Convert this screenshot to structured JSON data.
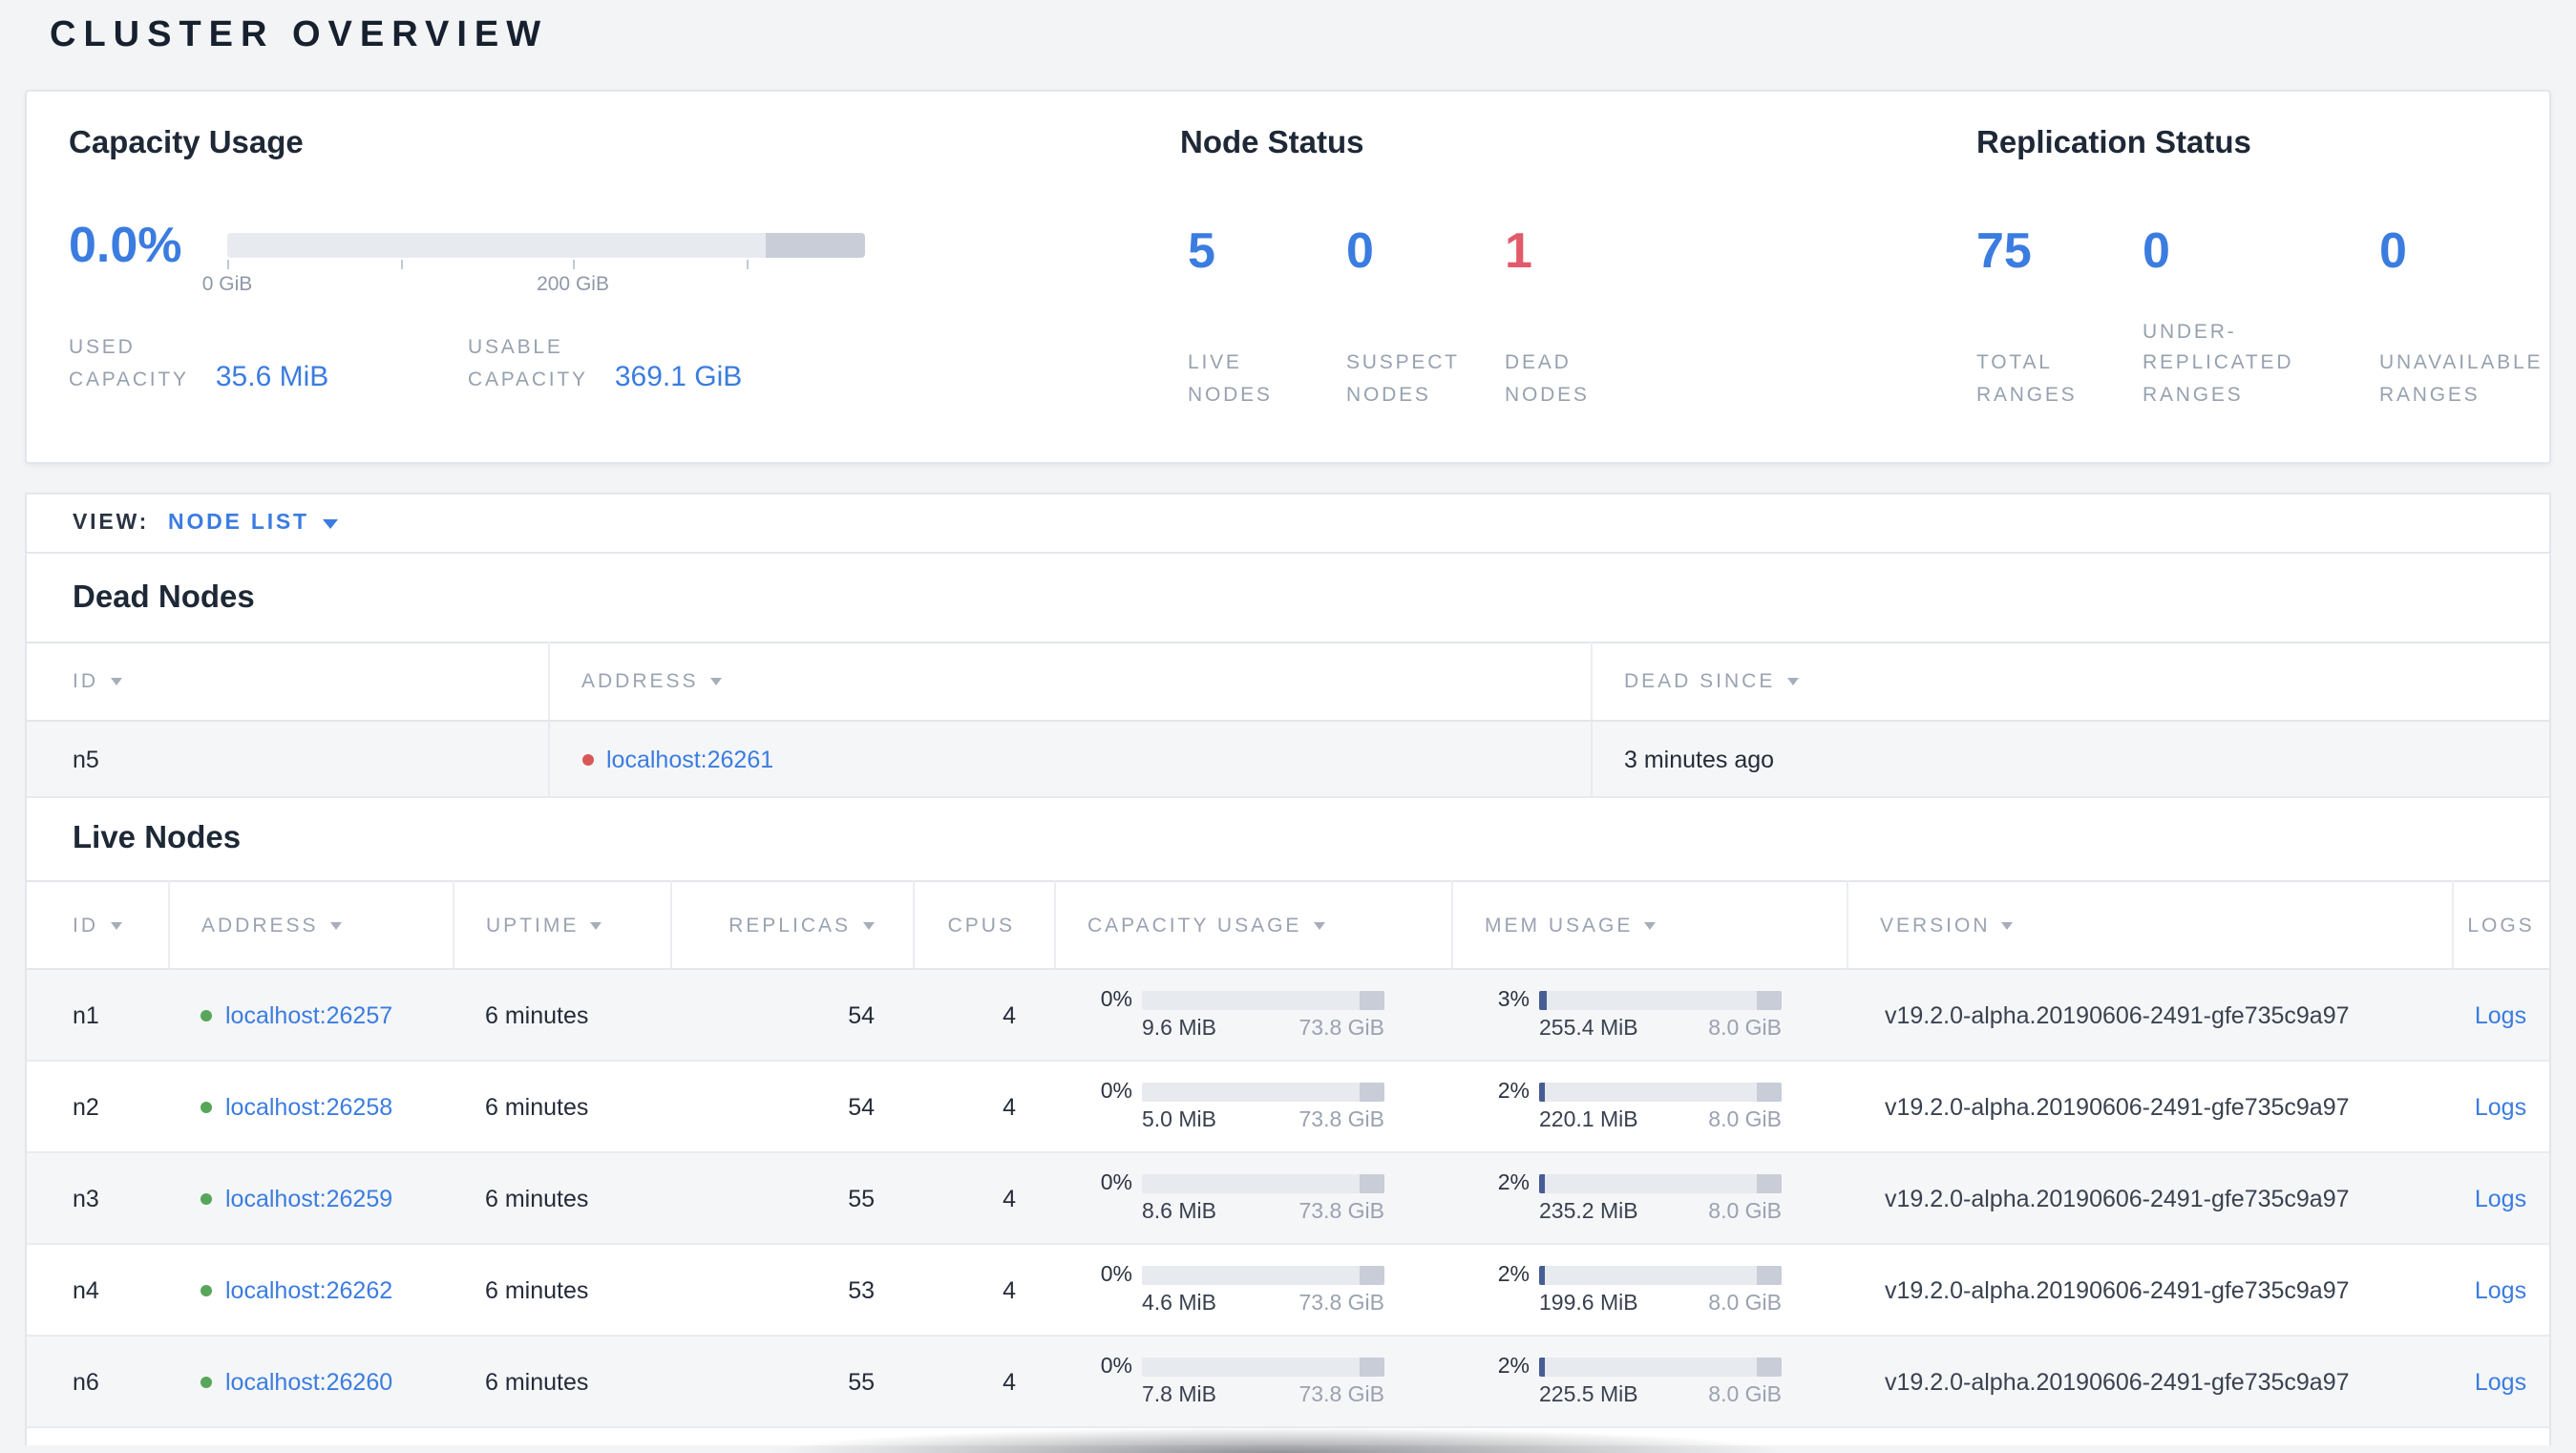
{
  "page": {
    "title": "CLUSTER OVERVIEW"
  },
  "colors": {
    "accent_blue": "#3b7ce0",
    "danger_red": "#e25b6b",
    "live_green": "#57a65a",
    "dead_red": "#d95757",
    "bar_fill": "#475d94",
    "bar_other": "#c8cdd8"
  },
  "icons": {
    "sort_desc": "▼",
    "chevron_down": "▼",
    "status_dot": "●"
  },
  "summary": {
    "capacity": {
      "title": "Capacity Usage",
      "percent": "0.0%",
      "bar": {
        "used_width": "0%",
        "other_width": "15.5%",
        "ticks": [
          {
            "pos": "0%",
            "label": "0 GiB"
          },
          {
            "pos": "27.1%",
            "label": ""
          },
          {
            "pos": "54.2%",
            "label": "200 GiB"
          },
          {
            "pos": "81.3%",
            "label": ""
          }
        ]
      },
      "stats": [
        {
          "label": "USED\nCAPACITY",
          "value": "35.6 MiB"
        },
        {
          "label": "USABLE\nCAPACITY",
          "value": "369.1 GiB"
        }
      ]
    },
    "node_status": {
      "title": "Node Status",
      "stats": [
        {
          "value": "5",
          "label": "LIVE\nNODES",
          "color": "#3b7ce0"
        },
        {
          "value": "0",
          "label": "SUSPECT\nNODES",
          "color": "#3b7ce0"
        },
        {
          "value": "1",
          "label": "DEAD\nNODES",
          "color": "#e25b6b"
        }
      ]
    },
    "replication": {
      "title": "Replication Status",
      "stats": [
        {
          "value": "75",
          "label": "TOTAL\nRANGES",
          "color": "#3b7ce0"
        },
        {
          "value": "0",
          "label": "UNDER-\nREPLICATED\nRANGES",
          "color": "#3b7ce0"
        },
        {
          "value": "0",
          "label": "UNAVAILABLE\nRANGES",
          "color": "#3b7ce0"
        }
      ]
    }
  },
  "view_bar": {
    "label": "VIEW:",
    "selected": "NODE LIST"
  },
  "dead_nodes": {
    "title": "Dead Nodes",
    "columns": {
      "id": "ID",
      "address": "ADDRESS",
      "dead_since": "DEAD SINCE"
    },
    "rows": [
      {
        "id": "n5",
        "address": "localhost:26261",
        "dead_since": "3 minutes ago"
      }
    ]
  },
  "live_nodes": {
    "title": "Live Nodes",
    "columns": {
      "id": "ID",
      "address": "ADDRESS",
      "uptime": "UPTIME",
      "replicas": "REPLICAS",
      "cpus": "CPUS",
      "capacity": "CAPACITY USAGE",
      "mem": "MEM USAGE",
      "version": "VERSION",
      "logs": "LOGS"
    },
    "rows": [
      {
        "id": "n1",
        "address": "localhost:26257",
        "uptime": "6 minutes",
        "replicas": "54",
        "cpus": "4",
        "cap_pct": "0%",
        "cap_fill": "0%",
        "cap_other": "10%",
        "cap_used": "9.6 MiB",
        "cap_total": "73.8 GiB",
        "mem_pct": "3%",
        "mem_fill": "3%",
        "mem_other": "10%",
        "mem_used": "255.4 MiB",
        "mem_total": "8.0 GiB",
        "version": "v19.2.0-alpha.20190606-2491-gfe735c9a97",
        "logs": "Logs"
      },
      {
        "id": "n2",
        "address": "localhost:26258",
        "uptime": "6 minutes",
        "replicas": "54",
        "cpus": "4",
        "cap_pct": "0%",
        "cap_fill": "0%",
        "cap_other": "10%",
        "cap_used": "5.0 MiB",
        "cap_total": "73.8 GiB",
        "mem_pct": "2%",
        "mem_fill": "2%",
        "mem_other": "10%",
        "mem_used": "220.1 MiB",
        "mem_total": "8.0 GiB",
        "version": "v19.2.0-alpha.20190606-2491-gfe735c9a97",
        "logs": "Logs"
      },
      {
        "id": "n3",
        "address": "localhost:26259",
        "uptime": "6 minutes",
        "replicas": "55",
        "cpus": "4",
        "cap_pct": "0%",
        "cap_fill": "0%",
        "cap_other": "10%",
        "cap_used": "8.6 MiB",
        "cap_total": "73.8 GiB",
        "mem_pct": "2%",
        "mem_fill": "2%",
        "mem_other": "10%",
        "mem_used": "235.2 MiB",
        "mem_total": "8.0 GiB",
        "version": "v19.2.0-alpha.20190606-2491-gfe735c9a97",
        "logs": "Logs"
      },
      {
        "id": "n4",
        "address": "localhost:26262",
        "uptime": "6 minutes",
        "replicas": "53",
        "cpus": "4",
        "cap_pct": "0%",
        "cap_fill": "0%",
        "cap_other": "10%",
        "cap_used": "4.6 MiB",
        "cap_total": "73.8 GiB",
        "mem_pct": "2%",
        "mem_fill": "2%",
        "mem_other": "10%",
        "mem_used": "199.6 MiB",
        "mem_total": "8.0 GiB",
        "version": "v19.2.0-alpha.20190606-2491-gfe735c9a97",
        "logs": "Logs"
      },
      {
        "id": "n6",
        "address": "localhost:26260",
        "uptime": "6 minutes",
        "replicas": "55",
        "cpus": "4",
        "cap_pct": "0%",
        "cap_fill": "0%",
        "cap_other": "10%",
        "cap_used": "7.8 MiB",
        "cap_total": "73.8 GiB",
        "mem_pct": "2%",
        "mem_fill": "2%",
        "mem_other": "10%",
        "mem_used": "225.5 MiB",
        "mem_total": "8.0 GiB",
        "version": "v19.2.0-alpha.20190606-2491-gfe735c9a97",
        "logs": "Logs"
      }
    ]
  }
}
